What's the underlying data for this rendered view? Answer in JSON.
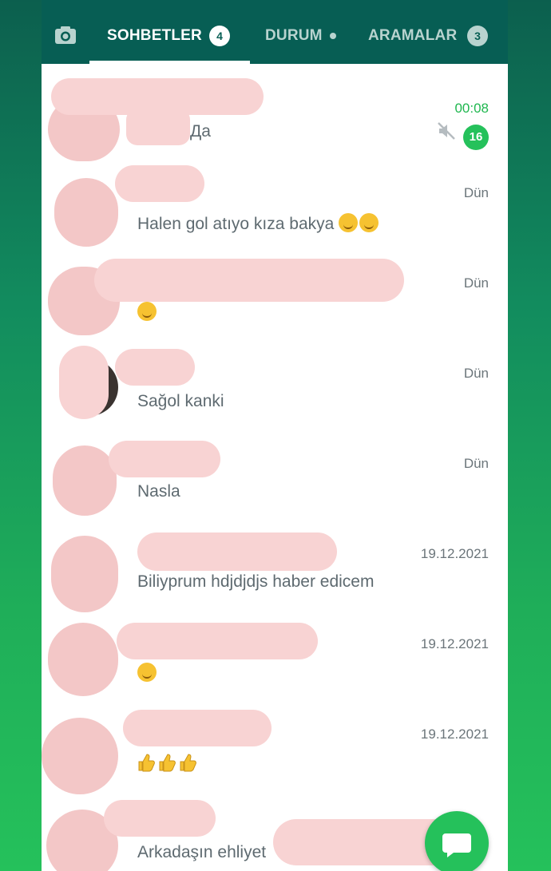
{
  "tabs": {
    "camera_icon": "camera-icon",
    "chats": {
      "label": "SOHBETLER",
      "badge": "4"
    },
    "status": {
      "label": "DURUM"
    },
    "calls": {
      "label": "ARAMALAR",
      "badge": "3"
    }
  },
  "colors": {
    "appbar": "#075e54",
    "accent": "#25c15b",
    "redaction": "#f8d3d3"
  },
  "chats": [
    {
      "preview": "Да",
      "time": "00:08",
      "muted": true,
      "unread": "16"
    },
    {
      "preview": "Halen gol atıyo kıza bakya",
      "emoji_icons": [
        "grinning-sweat-emoji",
        "grinning-sweat-emoji"
      ],
      "time": "Dün"
    },
    {
      "preview": "",
      "emoji_icons": [
        "smiling-blush-emoji"
      ],
      "time": "Dün"
    },
    {
      "preview": "Sağol kanki",
      "time": "Dün"
    },
    {
      "preview": "Nasla",
      "time": "Dün"
    },
    {
      "preview": "Biliyprum hdjdjdjs haber edicem",
      "time": "19.12.2021"
    },
    {
      "preview": "",
      "emoji_icons": [
        "smiling-blush-emoji"
      ],
      "time": "19.12.2021"
    },
    {
      "preview": "",
      "emoji_icons": [
        "thumbs-up-emoji",
        "thumbs-up-emoji",
        "thumbs-up-emoji"
      ],
      "time": "19.12.2021"
    },
    {
      "preview": "Arkadaşın ehliyet",
      "time": ""
    }
  ],
  "fab": {
    "icon": "new-chat-icon"
  }
}
